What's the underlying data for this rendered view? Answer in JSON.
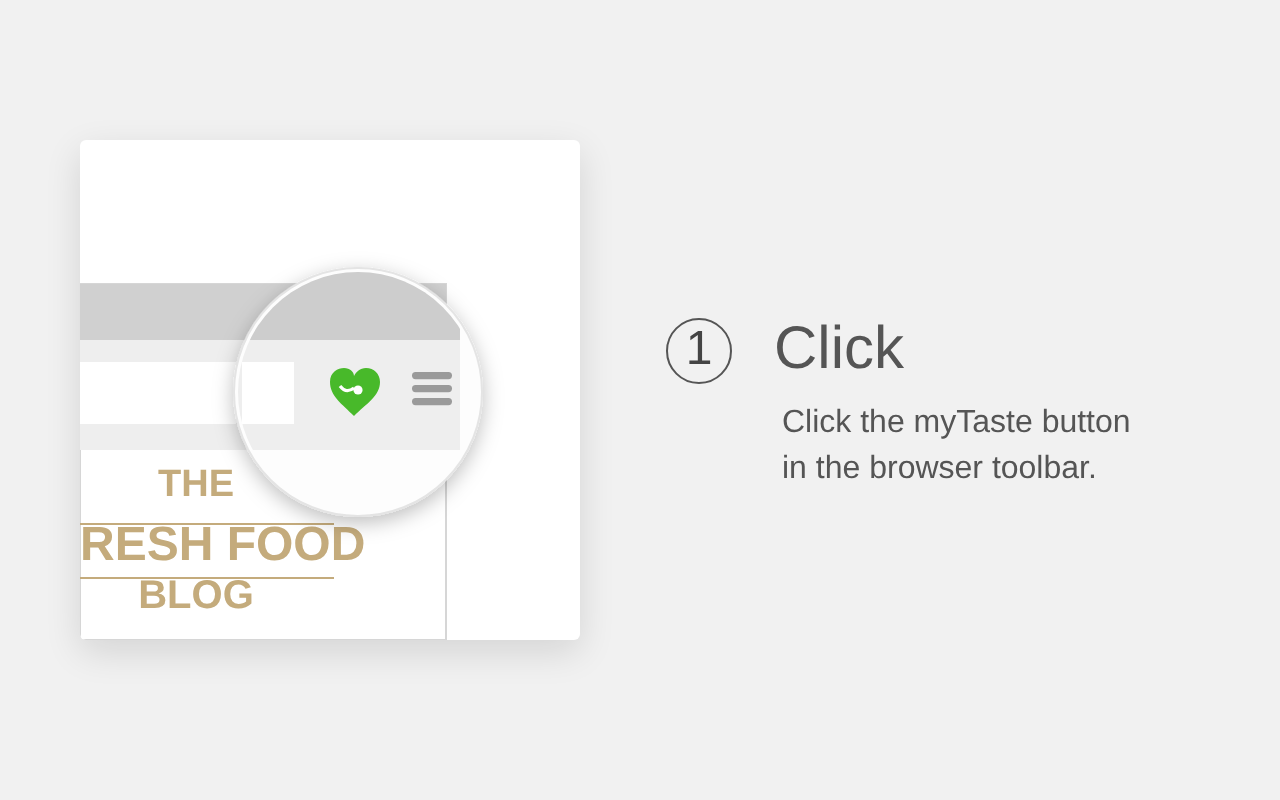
{
  "illustration": {
    "logo_lines": [
      "THE",
      "RESH FOOD",
      "BLOG"
    ]
  },
  "step": {
    "number": "1",
    "title": "Click",
    "description": "Click the myTaste button in the browser toolbar."
  }
}
